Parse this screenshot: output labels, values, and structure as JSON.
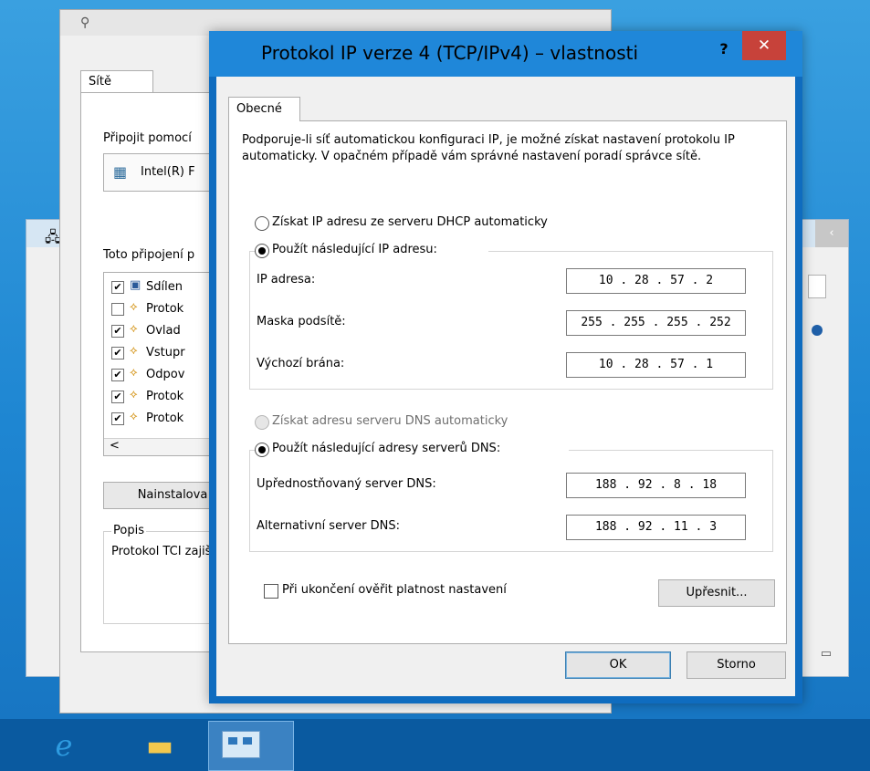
{
  "background_window": {
    "close_glyph": "‹"
  },
  "properties_window": {
    "tab": "Sítě",
    "connect_using_label": "Připojit pomocí",
    "adapter_name": "Intel(R) F",
    "uses_items_label": "Toto připojení p",
    "components": [
      {
        "checked": true,
        "label": "Sdílen"
      },
      {
        "checked": false,
        "label": "Protok"
      },
      {
        "checked": true,
        "label": "Ovlad"
      },
      {
        "checked": true,
        "label": "Vstupr"
      },
      {
        "checked": true,
        "label": "Odpov"
      },
      {
        "checked": true,
        "label": "Protok"
      },
      {
        "checked": true,
        "label": "Protok"
      }
    ],
    "scroll_left": "<",
    "install_button": "Nainstalova",
    "description_legend": "Popis",
    "description_text": "Protokol TCI zajišťuje kom"
  },
  "dialog": {
    "title": "Protokol IP verze 4 (TCP/IPv4) – vlastnosti",
    "help_glyph": "?",
    "close_glyph": "✕",
    "tab": "Obecné",
    "intro": "Podporuje-li síť automatickou konfiguraci IP, je možné získat nastavení protokolu IP automaticky. V opačném případě vám správné nastavení poradí správce sítě.",
    "ip_auto_label": "Získat IP adresu ze serveru DHCP automaticky",
    "ip_manual_label": "Použít následující IP adresu:",
    "ip_address_label": "IP adresa:",
    "ip_address_value": "10 . 28 . 57 . 2",
    "subnet_label": "Maska podsítě:",
    "subnet_value": "255 . 255 . 255 . 252",
    "gateway_label": "Výchozí brána:",
    "gateway_value": "10 . 28 . 57 . 1",
    "dns_auto_label": "Získat adresu serveru DNS automaticky",
    "dns_manual_label": "Použít následující adresy serverů DNS:",
    "dns_preferred_label": "Upřednostňovaný server DNS:",
    "dns_preferred_value": "188 . 92 . 8 . 18",
    "dns_alternate_label": "Alternativní server DNS:",
    "dns_alternate_value": "188 . 92 . 11 . 3",
    "validate_label": "Při ukončení ověřit platnost nastavení",
    "advanced_button": "Upřesnit...",
    "ok_button": "OK",
    "cancel_button": "Storno"
  },
  "taskbar": {
    "ie_glyph": "e",
    "folder_glyph": "▬"
  }
}
